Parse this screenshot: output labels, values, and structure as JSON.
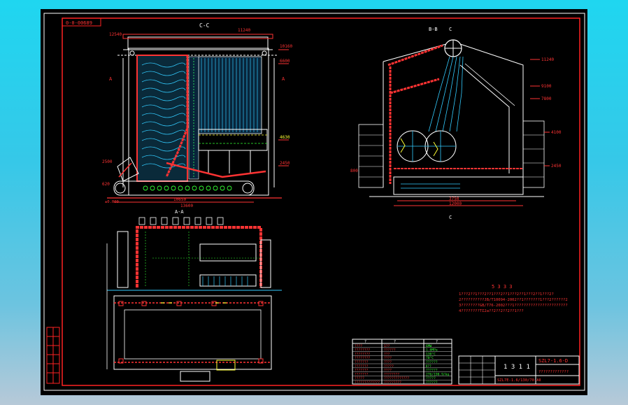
{
  "drawing_number_tag": "0-0-00689",
  "front_view": {
    "section_label": "C-C",
    "section_mark_left": "A",
    "section_mark_right": "A",
    "top_left_elev": "12540",
    "top_right_elev": "11240",
    "right_elev_1": "10160",
    "right_elev_2": "6600",
    "right_elev_3": "4630",
    "right_elev_4": "2450",
    "left_elev_1": "2500",
    "left_elev_2": "620",
    "bottom_dim": "10650",
    "bottom_dim_total": "13600",
    "zero_mark": "±0.000",
    "view_label": "A-A"
  },
  "side_view": {
    "section_label": "B-B",
    "top_mark": "C",
    "bottom_mark": "C",
    "elev_1": "11240",
    "elev_2": "9100",
    "elev_3": "7800",
    "elev_4": "4100",
    "elev_5": "2450",
    "left_elev": "800",
    "bottom_dim_1": "3750",
    "bottom_dim_2": "12000"
  },
  "notes": {
    "heading": "5 3 3 3",
    "lines": [
      "1???2??1???2??1???2??1???2??1???2??1???2?",
      "2??????????JB/T10094-2002??1???????1???2??????2",
      "3????????GB/T76-2002???1???????????????????????",
      "4????????TI2a??2??2??2??1???"
    ]
  },
  "params_table": {
    "header": [
      "?",
      "?",
      "?"
    ],
    "rows": [
      [
        "????",
        "1??",
        "6MW"
      ],
      [
        "????????",
        "??????",
        "1.6MPa"
      ],
      [
        "????????",
        "???",
        "130°C"
      ],
      [
        "????????",
        "????",
        "70°C"
      ],
      [
        "???????",
        "????",
        "??????"
      ],
      [
        "???????",
        "?????",
        "Ⅱ??"
      ],
      [
        "???????",
        "????",
        "??????"
      ],
      [
        "???????",
        "????????",
        "276/190.9/kg"
      ],
      [
        "?????",
        "?????????????",
        "?????"
      ],
      [
        "?????????????",
        "?????????",
        "??????"
      ]
    ]
  },
  "title_block": {
    "title_text": "1 3 1 1",
    "drawing_no": "SZL7-1.6-D",
    "model_label": "SZL7E-1.6/130/70-AⅡ",
    "sub_label": "?????????????"
  }
}
